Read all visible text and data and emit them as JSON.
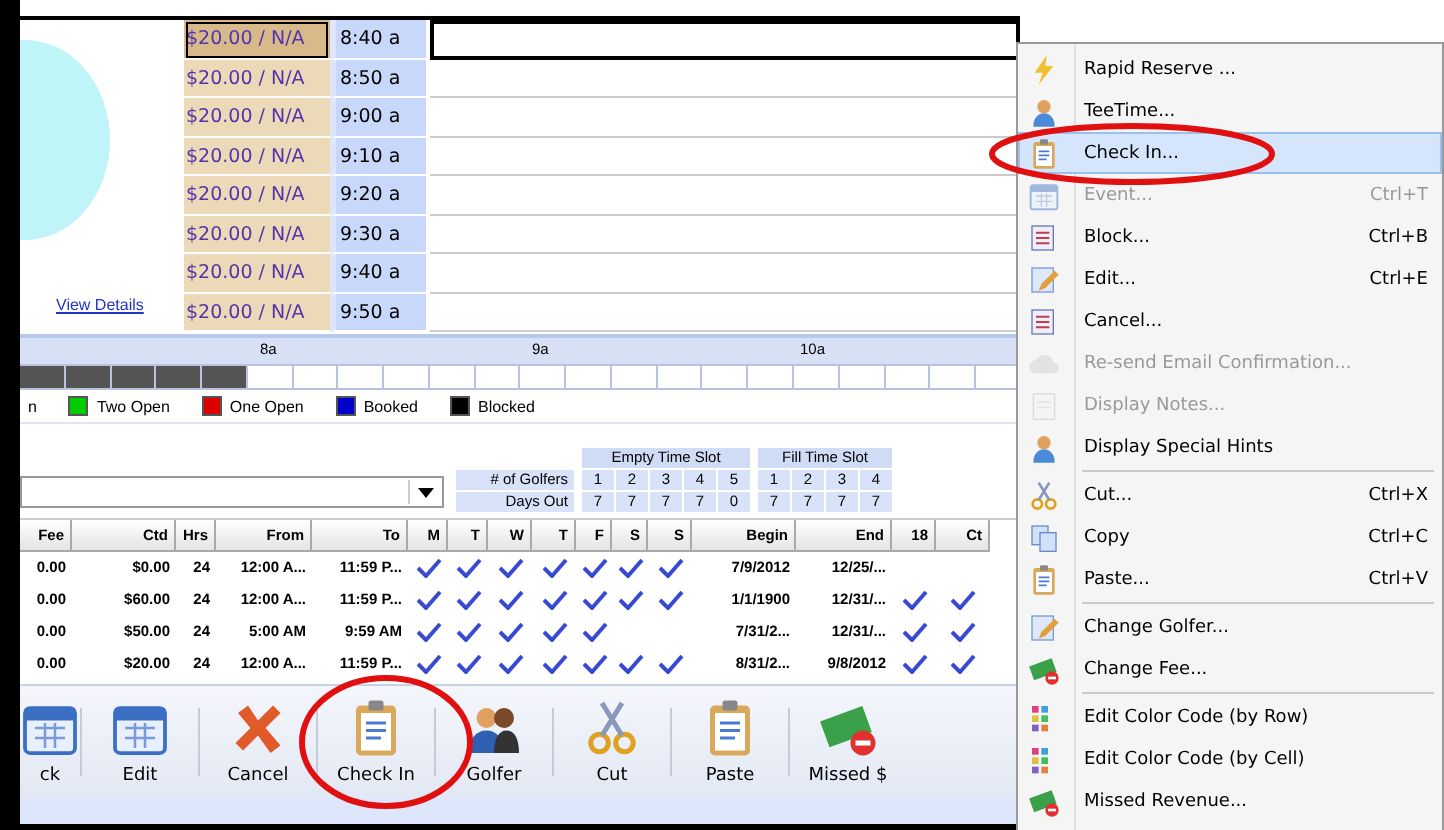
{
  "tee_sheet": {
    "link": "View Details",
    "rows": [
      {
        "fee": "$20.00 / N/A",
        "time": "8:40 a",
        "selected": true
      },
      {
        "fee": "$20.00 / N/A",
        "time": "8:50 a",
        "selected": false
      },
      {
        "fee": "$20.00 / N/A",
        "time": "9:00 a",
        "selected": false
      },
      {
        "fee": "$20.00 / N/A",
        "time": "9:10 a",
        "selected": false
      },
      {
        "fee": "$20.00 / N/A",
        "time": "9:20 a",
        "selected": false
      },
      {
        "fee": "$20.00 / N/A",
        "time": "9:30 a",
        "selected": false
      },
      {
        "fee": "$20.00 / N/A",
        "time": "9:40 a",
        "selected": false
      },
      {
        "fee": "$20.00 / N/A",
        "time": "9:50 a",
        "selected": false
      }
    ]
  },
  "timeline": {
    "hours": [
      "8a",
      "9a",
      "10a"
    ],
    "slots": [
      {
        "filled": true
      },
      {
        "filled": true
      },
      {
        "filled": true
      },
      {
        "filled": true
      },
      {
        "filled": true
      },
      {
        "filled": false
      },
      {
        "filled": false
      },
      {
        "filled": false
      },
      {
        "filled": false
      },
      {
        "filled": false
      },
      {
        "filled": false
      },
      {
        "filled": false
      },
      {
        "filled": false
      },
      {
        "filled": false
      },
      {
        "filled": false
      },
      {
        "filled": false
      },
      {
        "filled": false
      },
      {
        "filled": false
      },
      {
        "filled": false
      },
      {
        "filled": false
      },
      {
        "filled": false
      },
      {
        "filled": false
      }
    ]
  },
  "legend": [
    {
      "label": "n"
    },
    {
      "label": "Two Open",
      "color": "#00cc00"
    },
    {
      "label": "One Open",
      "color": "#dd0000"
    },
    {
      "label": "Booked",
      "color": "#0000cc"
    },
    {
      "label": "Blocked",
      "color": "#000000"
    }
  ],
  "golfer_table": {
    "row_labels": [
      "# of Golfers",
      "Days Out"
    ],
    "groups": [
      {
        "title": "Empty Time Slot",
        "slots": [
          {
            "golfers": "1",
            "days_out": "7"
          },
          {
            "golfers": "2",
            "days_out": "7"
          },
          {
            "golfers": "3",
            "days_out": "7"
          },
          {
            "golfers": "4",
            "days_out": "7"
          },
          {
            "golfers": "5",
            "days_out": "0"
          }
        ]
      },
      {
        "title": "Fill Time Slot",
        "slots": [
          {
            "golfers": "1",
            "days_out": "7"
          },
          {
            "golfers": "2",
            "days_out": "7"
          },
          {
            "golfers": "3",
            "days_out": "7"
          },
          {
            "golfers": "4",
            "days_out": "7"
          }
        ]
      }
    ]
  },
  "grid": {
    "columns": [
      "Fee",
      "Ctd",
      "Hrs",
      "From",
      "To",
      "M",
      "T",
      "W",
      "T",
      "F",
      "S",
      "S",
      "Begin",
      "End",
      "18",
      "Ct"
    ],
    "rows": [
      {
        "fee": "0.00",
        "ctd": "$0.00",
        "hrs": "24",
        "from": "12:00 A...",
        "to": "11:59 P...",
        "days": [
          true,
          true,
          true,
          true,
          true,
          true,
          true
        ],
        "begin": "7/9/2012",
        "end": "12/25/...",
        "holes_18": false,
        "cart": false
      },
      {
        "fee": "0.00",
        "ctd": "$60.00",
        "hrs": "24",
        "from": "12:00 A...",
        "to": "11:59 P...",
        "days": [
          true,
          true,
          true,
          true,
          true,
          true,
          true
        ],
        "begin": "1/1/1900",
        "end": "12/31/...",
        "holes_18": true,
        "cart": true
      },
      {
        "fee": "0.00",
        "ctd": "$50.00",
        "hrs": "24",
        "from": "5:00 AM",
        "to": "9:59 AM",
        "days": [
          true,
          true,
          true,
          true,
          true,
          false,
          false
        ],
        "begin": "7/31/2...",
        "end": "12/31/...",
        "holes_18": true,
        "cart": true
      },
      {
        "fee": "0.00",
        "ctd": "$20.00",
        "hrs": "24",
        "from": "12:00 A...",
        "to": "11:59 P...",
        "days": [
          true,
          true,
          true,
          true,
          true,
          true,
          true
        ],
        "begin": "8/31/2...",
        "end": "9/8/2012",
        "holes_18": true,
        "cart": true
      }
    ]
  },
  "toolbar": [
    {
      "label": "ck"
    },
    {
      "label": "Edit"
    },
    {
      "label": "Cancel"
    },
    {
      "label": "Check In"
    },
    {
      "label": "Golfer"
    },
    {
      "label": "Cut"
    },
    {
      "label": "Paste"
    },
    {
      "label": "Missed $"
    }
  ],
  "context_menu": [
    {
      "kind": "item",
      "label": "Rapid Reserve ...",
      "selected": false,
      "disabled": false
    },
    {
      "kind": "item",
      "label": "TeeTime...",
      "selected": false,
      "disabled": false
    },
    {
      "kind": "item",
      "label": "Check In...",
      "selected": true,
      "disabled": false
    },
    {
      "kind": "item",
      "label": "Event...",
      "shortcut": "Ctrl+T",
      "selected": false,
      "disabled": true
    },
    {
      "kind": "item",
      "label": "Block...",
      "shortcut": "Ctrl+B",
      "selected": false,
      "disabled": false
    },
    {
      "kind": "item",
      "label": "Edit...",
      "shortcut": "Ctrl+E",
      "selected": false,
      "disabled": false
    },
    {
      "kind": "item",
      "label": "Cancel...",
      "selected": false,
      "disabled": false
    },
    {
      "kind": "item",
      "label": "Re-send Email Confirmation...",
      "selected": false,
      "disabled": true
    },
    {
      "kind": "item",
      "label": "Display Notes...",
      "selected": false,
      "disabled": true
    },
    {
      "kind": "item",
      "label": "Display Special Hints",
      "selected": false,
      "disabled": false
    },
    {
      "kind": "separator"
    },
    {
      "kind": "item",
      "label": "Cut...",
      "shortcut": "Ctrl+X",
      "selected": false,
      "disabled": false
    },
    {
      "kind": "item",
      "label": "Copy",
      "shortcut": "Ctrl+C",
      "selected": false,
      "disabled": false
    },
    {
      "kind": "item",
      "label": "Paste...",
      "shortcut": "Ctrl+V",
      "selected": false,
      "disabled": false
    },
    {
      "kind": "separator"
    },
    {
      "kind": "item",
      "label": "Change Golfer...",
      "selected": false,
      "disabled": false
    },
    {
      "kind": "item",
      "label": "Change Fee...",
      "selected": false,
      "disabled": false
    },
    {
      "kind": "separator"
    },
    {
      "kind": "item",
      "label": "Edit Color Code (by Row)",
      "selected": false,
      "disabled": false
    },
    {
      "kind": "item",
      "label": "Edit Color Code (by Cell)",
      "selected": false,
      "disabled": false
    },
    {
      "kind": "item",
      "label": "Missed Revenue...",
      "selected": false,
      "disabled": false
    }
  ],
  "annotations": [
    {
      "kind": "circle"
    },
    {
      "kind": "circle"
    }
  ]
}
